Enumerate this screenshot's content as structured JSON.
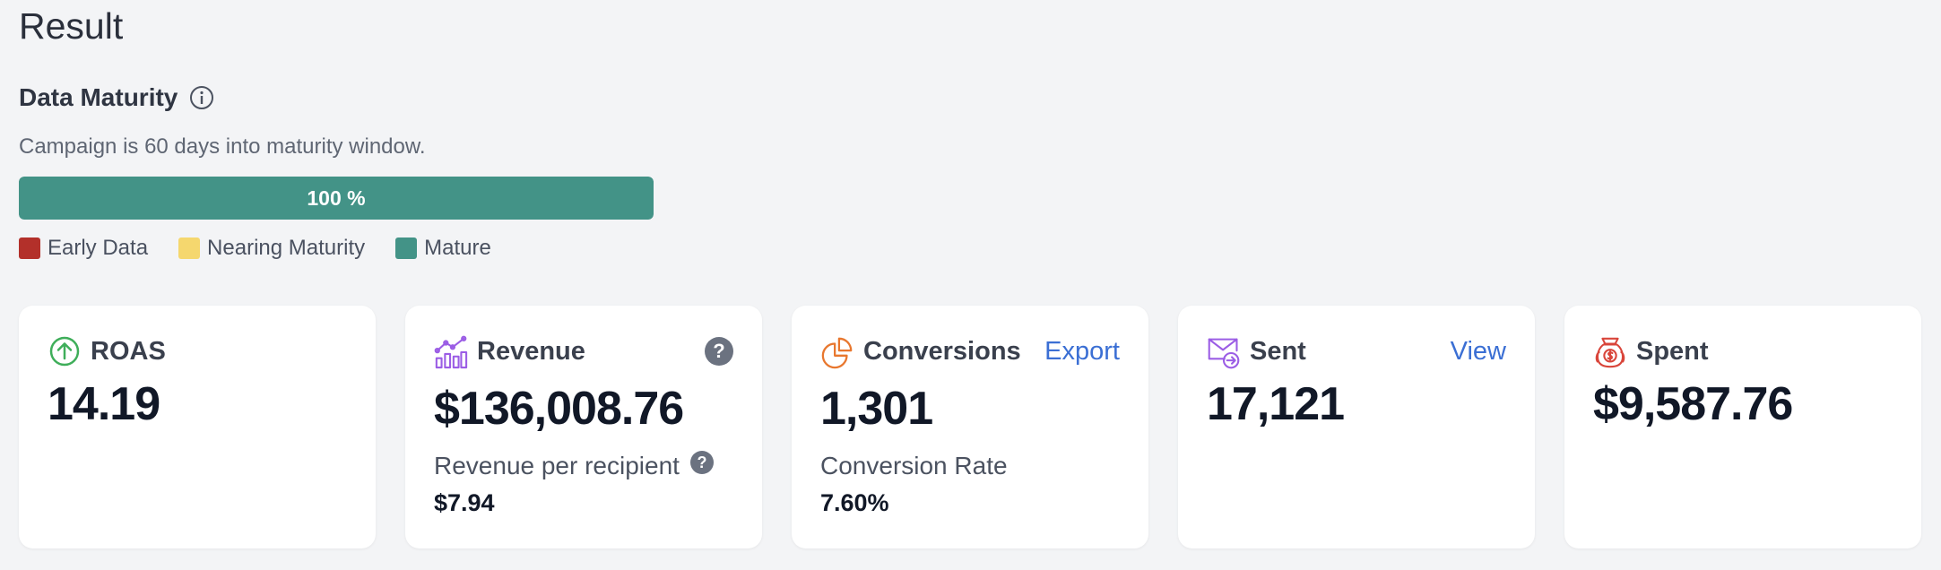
{
  "page": {
    "title": "Result"
  },
  "maturity": {
    "title": "Data Maturity",
    "description": "Campaign is 60 days into maturity window.",
    "progress_percent": 100,
    "progress_label": "100 %",
    "legend": [
      {
        "label": "Early Data",
        "color": "#b3302a"
      },
      {
        "label": "Nearing Maturity",
        "color": "#f5d76e"
      },
      {
        "label": "Mature",
        "color": "#439387"
      }
    ]
  },
  "cards": {
    "roas": {
      "label": "ROAS",
      "value": "14.19",
      "icon": "arrow-up-circle-icon"
    },
    "revenue": {
      "label": "Revenue",
      "value": "$136,008.76",
      "icon": "bar-chart-trend-icon",
      "sub_label": "Revenue per recipient",
      "sub_value": "$7.94",
      "help": "?"
    },
    "conversions": {
      "label": "Conversions",
      "value": "1,301",
      "icon": "pie-chart-icon",
      "action": "Export",
      "sub_label": "Conversion Rate",
      "sub_value": "7.60%"
    },
    "sent": {
      "label": "Sent",
      "value": "17,121",
      "icon": "envelope-arrow-icon",
      "action": "View"
    },
    "spent": {
      "label": "Spent",
      "value": "$9,587.76",
      "icon": "money-bag-icon"
    }
  }
}
